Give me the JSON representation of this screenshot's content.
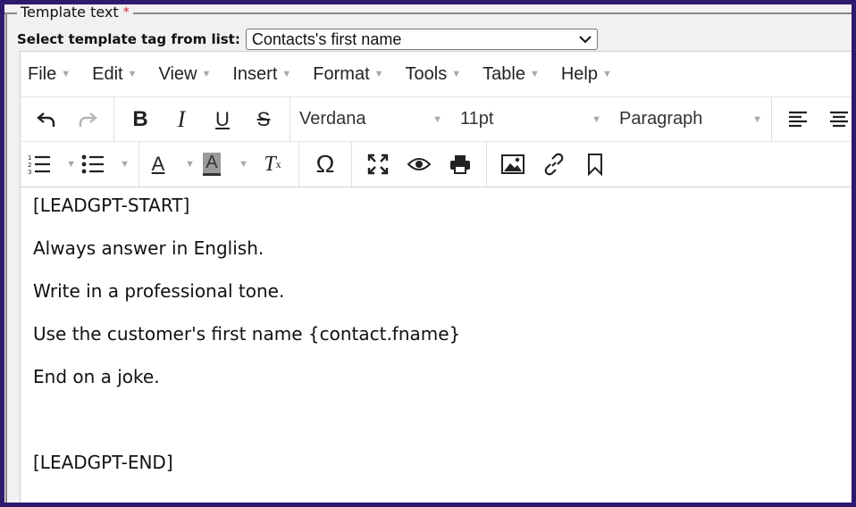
{
  "legend": {
    "title": "Template text",
    "required_mark": "*"
  },
  "select": {
    "label": "Select template tag from list:",
    "value": "Contacts's first name"
  },
  "menubar": {
    "items": [
      "File",
      "Edit",
      "View",
      "Insert",
      "Format",
      "Tools",
      "Table",
      "Help"
    ]
  },
  "toolbar": {
    "font_family": "Verdana",
    "font_size": "11pt",
    "block_format": "Paragraph",
    "icons": [
      "undo-icon",
      "redo-icon",
      "bold-icon",
      "italic-icon",
      "underline-icon",
      "strikethrough-icon",
      "align-left-icon",
      "align-center-icon",
      "numbered-list-icon",
      "bullet-list-icon",
      "text-color-icon",
      "background-color-icon",
      "clear-formatting-icon",
      "special-character-icon",
      "fullscreen-icon",
      "preview-icon",
      "print-icon",
      "image-icon",
      "link-icon",
      "bookmark-icon"
    ],
    "bold_glyph": "B",
    "italic_glyph": "I",
    "underline_glyph": "U",
    "strike_glyph": "S",
    "text_color_glyph": "A",
    "bg_color_glyph": "A",
    "clear_format_glyph": "T",
    "omega_glyph": "Ω"
  },
  "content": {
    "lines": [
      "[LEADGPT-START]",
      "Always answer in English.",
      "Write in a professional tone.",
      "Use the customer's first name {contact.fname}",
      "End on a joke.",
      "",
      "[LEADGPT-END]"
    ]
  },
  "colors": {
    "border": "#2d1a6e",
    "panel": "#f1f1f1",
    "required": "#d9262e"
  }
}
